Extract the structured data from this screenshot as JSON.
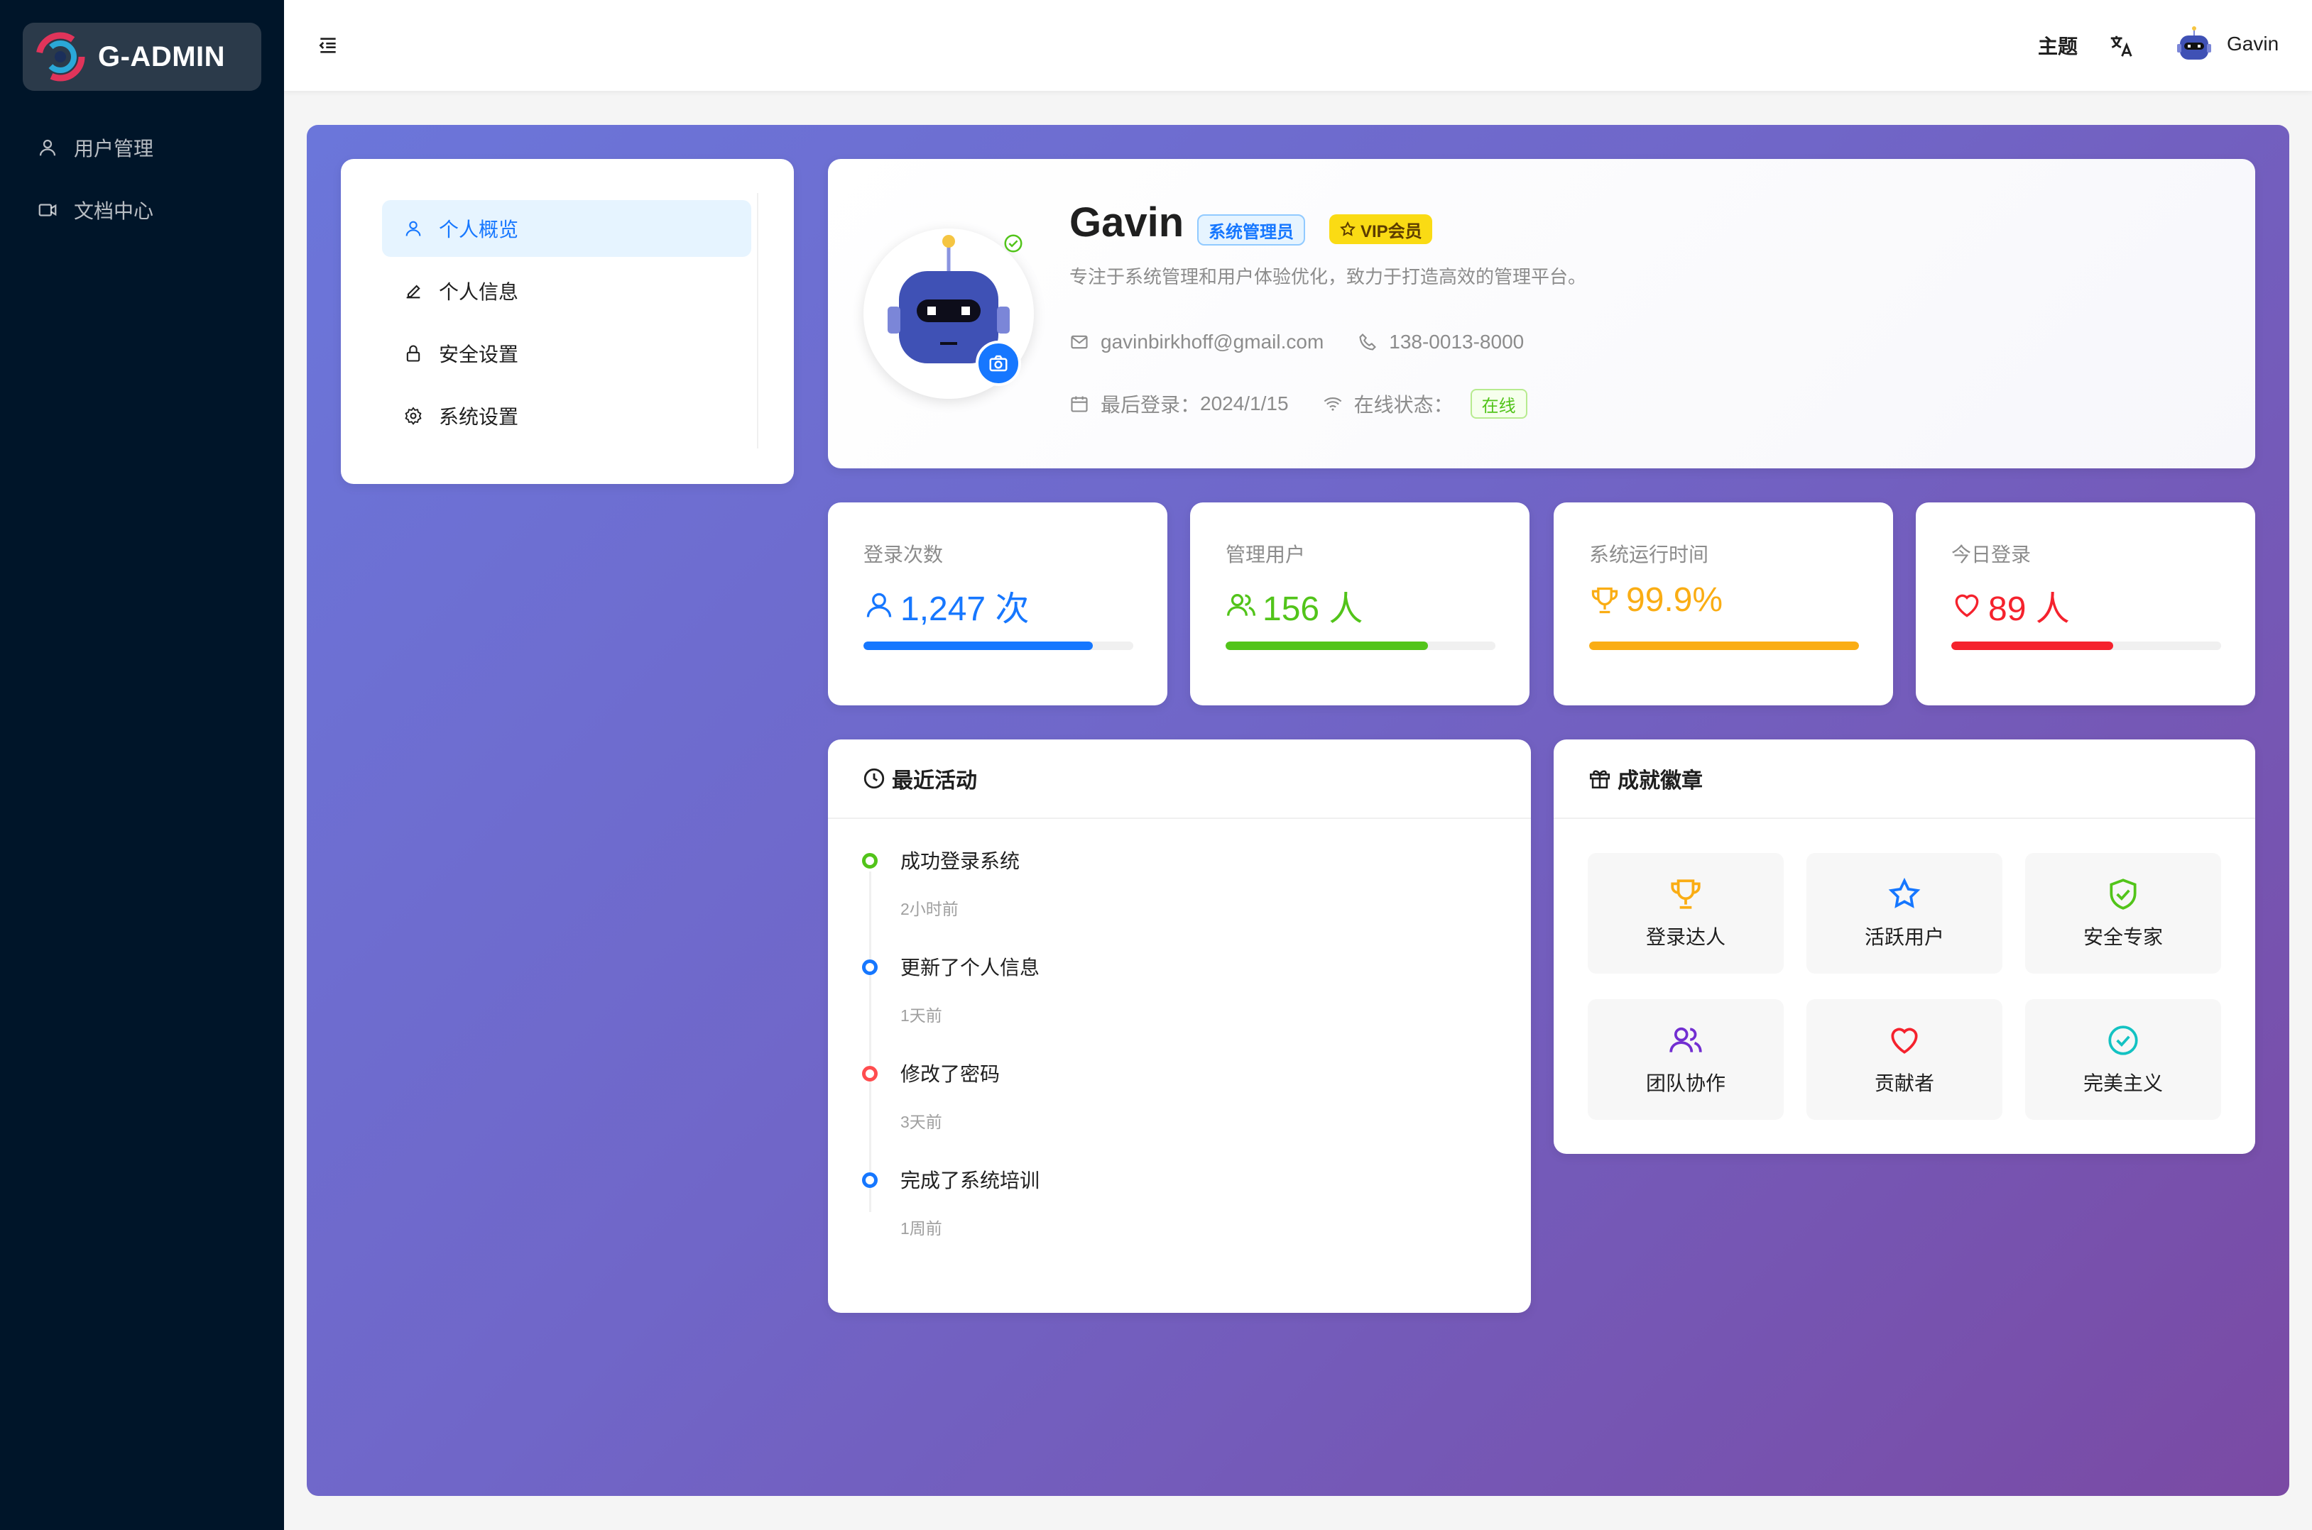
{
  "app": {
    "logo_text": "G-ADMIN"
  },
  "sidebar": {
    "items": [
      {
        "label": "用户管理",
        "icon": "user-icon"
      },
      {
        "label": "文档中心",
        "icon": "video-icon"
      }
    ]
  },
  "header": {
    "theme_label": "主题",
    "language_icon": "translate-icon",
    "username": "Gavin"
  },
  "profile_nav": {
    "items": [
      {
        "label": "个人概览",
        "icon": "user-icon",
        "active": true
      },
      {
        "label": "个人信息",
        "icon": "edit-icon",
        "active": false
      },
      {
        "label": "安全设置",
        "icon": "lock-icon",
        "active": false
      },
      {
        "label": "系统设置",
        "icon": "gear-icon",
        "active": false
      }
    ]
  },
  "profile": {
    "name": "Gavin",
    "role_tag": "系统管理员",
    "vip_tag": "VIP会员",
    "description": "专注于系统管理和用户体验优化，致力于打造高效的管理平台。",
    "email": "gavinbirkhoff@gmail.com",
    "phone": "138-0013-8000",
    "last_login_label": "最后登录：",
    "last_login": "2024/1/15",
    "status_label": "在线状态：",
    "status": "在线"
  },
  "stats": [
    {
      "title": "登录次数",
      "value": "1,247 次",
      "color": "#1677ff",
      "icon": "user-icon",
      "progress": 0.85
    },
    {
      "title": "管理用户",
      "value": "156 人",
      "color": "#52c41a",
      "icon": "team-icon",
      "progress": 0.75
    },
    {
      "title": "系统运行时间",
      "value": "99.9%",
      "color": "#faad14",
      "icon": "trophy-icon",
      "progress": 1.0
    },
    {
      "title": "今日登录",
      "value": "89 人",
      "color": "#f5222d",
      "icon": "heart-icon",
      "progress": 0.6
    }
  ],
  "activity": {
    "title": "最近活动",
    "items": [
      {
        "title": "成功登录系统",
        "time": "2小时前",
        "color": "#52c41a"
      },
      {
        "title": "更新了个人信息",
        "time": "1天前",
        "color": "#1677ff"
      },
      {
        "title": "修改了密码",
        "time": "3天前",
        "color": "#ff4d4f"
      },
      {
        "title": "完成了系统培训",
        "time": "1周前",
        "color": "#1677ff"
      }
    ]
  },
  "achievements": {
    "title": "成就徽章",
    "items": [
      {
        "label": "登录达人",
        "icon": "trophy-icon",
        "color": "#faad14"
      },
      {
        "label": "活跃用户",
        "icon": "star-icon",
        "color": "#1677ff"
      },
      {
        "label": "安全专家",
        "icon": "shield-check-icon",
        "color": "#52c41a"
      },
      {
        "label": "团队协作",
        "icon": "team-icon",
        "color": "#722ed1"
      },
      {
        "label": "贡献者",
        "icon": "heart-icon",
        "color": "#f5222d"
      },
      {
        "label": "完美主义",
        "icon": "check-circle-icon",
        "color": "#13c2c2"
      }
    ]
  }
}
